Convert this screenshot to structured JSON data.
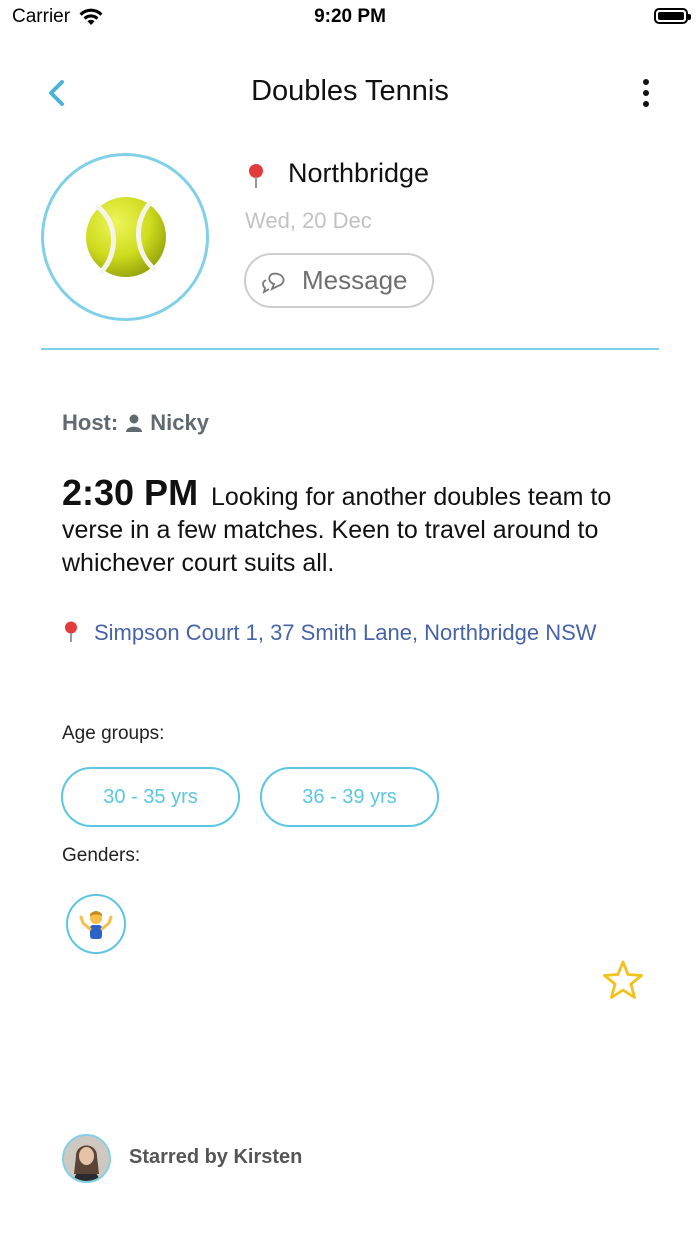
{
  "status_bar": {
    "carrier": "Carrier",
    "time": "9:20 PM"
  },
  "nav": {
    "title": "Doubles Tennis",
    "back_icon": "chevron-left-icon",
    "more_icon": "more-vertical-icon"
  },
  "event": {
    "icon": "tennis-ball-icon",
    "location": "Northbridge",
    "date": "Wed, 20 Dec",
    "message_label": "Message"
  },
  "host": {
    "label": "Host:",
    "name": "Nicky"
  },
  "description": {
    "time": "2:30 PM",
    "text": "Looking for another doubles team to verse in a few matches. Keen to travel around to whichever court suits all."
  },
  "address": "Simpson Court 1, 37 Smith Lane, Northbridge NSW",
  "age_groups": {
    "label": "Age groups:",
    "items": [
      "30 - 35 yrs",
      "36 - 39 yrs"
    ]
  },
  "genders": {
    "label": "Genders:",
    "items": [
      "person-shrugging-icon"
    ]
  },
  "starred": {
    "text": "Starred by Kirsten"
  },
  "colors": {
    "accent": "#5bc6e2",
    "link": "#4763a8",
    "star": "#f2c21a"
  }
}
